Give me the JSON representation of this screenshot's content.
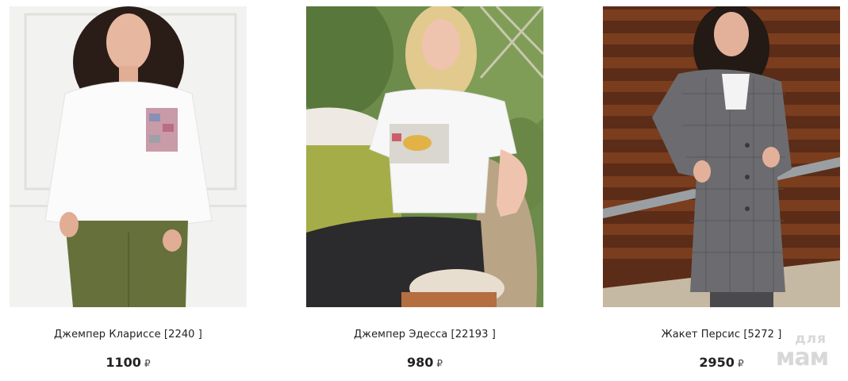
{
  "products": [
    {
      "name": "Джемпер Клариссе [2240 ]",
      "price": "1100",
      "currency": "₽",
      "image_desc": "woman in white sweatshirt and green trousers"
    },
    {
      "name": "Джемпер Эдесса [22193 ]",
      "price": "980",
      "currency": "₽",
      "image_desc": "blonde woman in white t-shirt seated in wicker chair"
    },
    {
      "name": "Жакет Персис [5272 ]",
      "price": "2950",
      "currency": "₽",
      "image_desc": "woman in grey plaid coat by wooden slat wall"
    }
  ],
  "watermark": {
    "line1": "для",
    "line2": "мам"
  },
  "colors": {
    "text": "#222222",
    "watermark": "#d8d8d8"
  }
}
